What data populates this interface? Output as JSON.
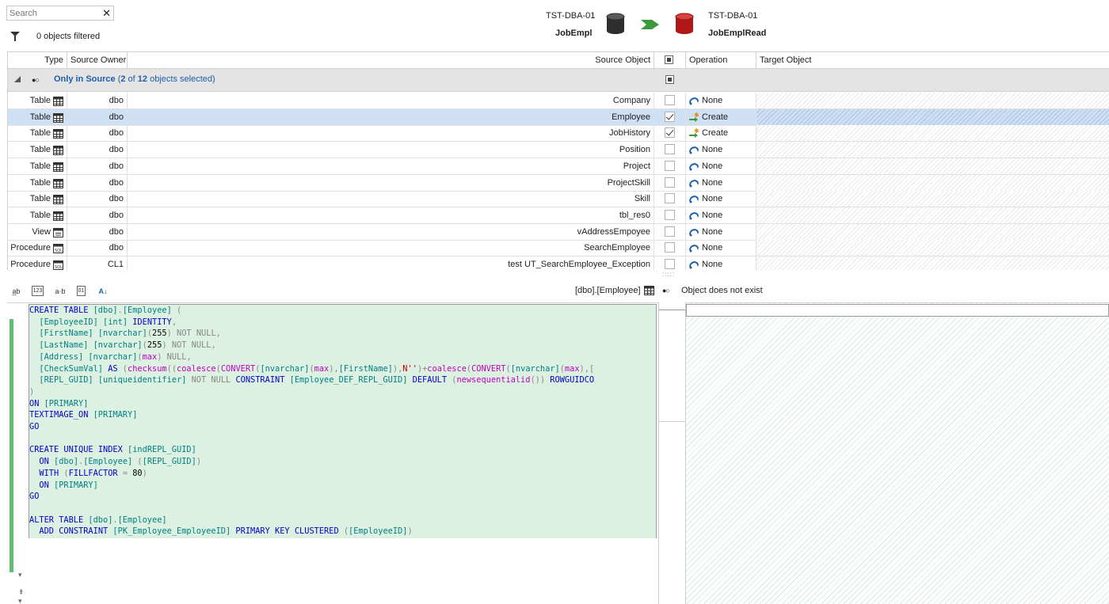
{
  "search": {
    "placeholder": "Search",
    "clear_glyph": "✕"
  },
  "filter": {
    "text": "0 objects filtered"
  },
  "source_db": {
    "server": "TST-DBA-01",
    "database": "JobEmpl"
  },
  "target_db": {
    "server": "TST-DBA-01",
    "database": "JobEmplRead"
  },
  "grid": {
    "headers": {
      "type": "Type",
      "owner": "Source Owner",
      "object": "Source Object",
      "operation": "Operation",
      "target": "Target Object"
    },
    "group": {
      "label": "Only in Source",
      "paren_open": " (",
      "selected": "2",
      "of": " of ",
      "total": "12",
      "suffix": " objects selected)"
    },
    "rows": [
      {
        "type": "Table",
        "owner": "dbo",
        "object": "Company",
        "checked": false,
        "operation": "None"
      },
      {
        "type": "Table",
        "owner": "dbo",
        "object": "Employee",
        "checked": true,
        "operation": "Create"
      },
      {
        "type": "Table",
        "owner": "dbo",
        "object": "JobHistory",
        "checked": true,
        "operation": "Create"
      },
      {
        "type": "Table",
        "owner": "dbo",
        "object": "Position",
        "checked": false,
        "operation": "None"
      },
      {
        "type": "Table",
        "owner": "dbo",
        "object": "Project",
        "checked": false,
        "operation": "None"
      },
      {
        "type": "Table",
        "owner": "dbo",
        "object": "ProjectSkill",
        "checked": false,
        "operation": "None"
      },
      {
        "type": "Table",
        "owner": "dbo",
        "object": "Skill",
        "checked": false,
        "operation": "None"
      },
      {
        "type": "Table",
        "owner": "dbo",
        "object": "tbl_res0",
        "checked": false,
        "operation": "None"
      },
      {
        "type": "View",
        "owner": "dbo",
        "object": "vAddressEmpoyee",
        "checked": false,
        "operation": "None"
      },
      {
        "type": "Procedure",
        "owner": "dbo",
        "object": "SearchEmployee",
        "checked": false,
        "operation": "None"
      },
      {
        "type": "Procedure",
        "owner": "CL1",
        "object": "test UT_SearchEmployee_Exception",
        "checked": false,
        "operation": "None"
      }
    ]
  },
  "toolbar": {
    "icons": [
      "ab-icon",
      "123-icon",
      "a-b-icon",
      "01-icon",
      "sort-az-icon"
    ],
    "icon_text": [
      "a̲b",
      "123",
      "a·b",
      "01",
      "A↓"
    ]
  },
  "detail": {
    "object_name": "[dbo].[Employee]",
    "status": "Object does not exist"
  },
  "code": {
    "lines": [
      "CREATE TABLE [dbo].[Employee] (",
      "  [EmployeeID] [int] IDENTITY,",
      "  [FirstName] [nvarchar](255) NOT NULL,",
      "  [LastName] [nvarchar](255) NOT NULL,",
      "  [Address] [nvarchar](max) NULL,",
      "  [CheckSumVal] AS (checksum((coalesce(CONVERT([nvarchar](max),[FirstName]),N'')+coalesce(CONVERT([nvarchar](max),[",
      "  [REPL_GUID] [uniqueidentifier] NOT NULL CONSTRAINT [Employee_DEF_REPL_GUID] DEFAULT (newsequentialid()) ROWGUIDCO",
      ")",
      "ON [PRIMARY]",
      "TEXTIMAGE_ON [PRIMARY]",
      "GO",
      "",
      "CREATE UNIQUE INDEX [indREPL_GUID]",
      "  ON [dbo].[Employee] ([REPL_GUID])",
      "  WITH (FILLFACTOR = 80)",
      "  ON [PRIMARY]",
      "GO",
      "",
      "ALTER TABLE [dbo].[Employee]",
      "  ADD CONSTRAINT [PK_Employee_EmployeeID] PRIMARY KEY CLUSTERED ([EmployeeID])"
    ]
  },
  "colors": {
    "selected_row": "#cfe0f5",
    "group_band": "#e4e4e4",
    "code_bg": "#dcf1e2",
    "change_bar": "#5cbf73",
    "keyword": "#0000cc",
    "identifier": "#008080",
    "function": "#c000c0",
    "group_label": "#1c5fae"
  }
}
